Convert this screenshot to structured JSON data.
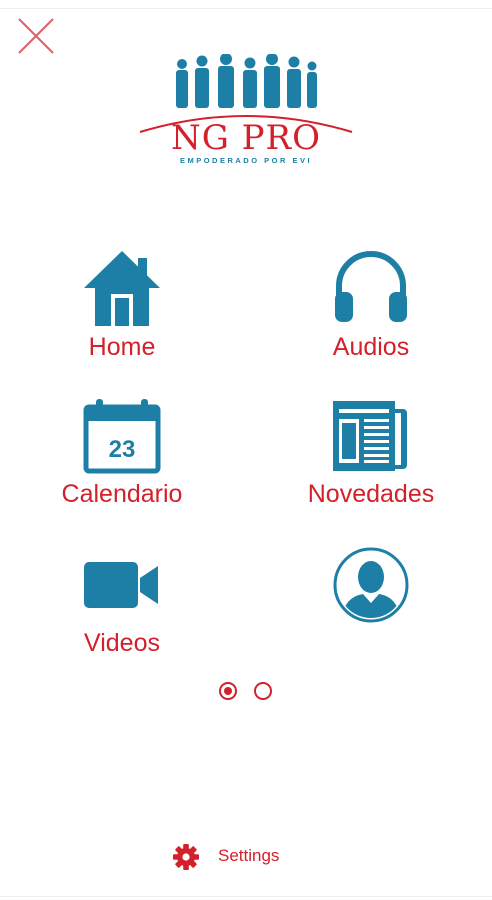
{
  "colors": {
    "accent": "#d4202b",
    "icon": "#1e7fa6"
  },
  "header": {
    "close_icon": "close-icon"
  },
  "logo": {
    "title": "NG PRO",
    "tagline": "EMPODERADO POR EVI"
  },
  "menu": {
    "items": [
      {
        "label": "Home",
        "icon": "house-icon"
      },
      {
        "label": "Audios",
        "icon": "headphones-icon"
      },
      {
        "label": "Calendario",
        "icon": "calendar-icon",
        "date": "23"
      },
      {
        "label": "Novedades",
        "icon": "newspaper-icon"
      },
      {
        "label": "Videos",
        "icon": "video-camera-icon"
      },
      {
        "label": "",
        "icon": "profile-icon"
      }
    ]
  },
  "pagination": {
    "pages": 2,
    "current": 1
  },
  "footer": {
    "settings_label": "Settings",
    "icon": "gear-icon"
  }
}
